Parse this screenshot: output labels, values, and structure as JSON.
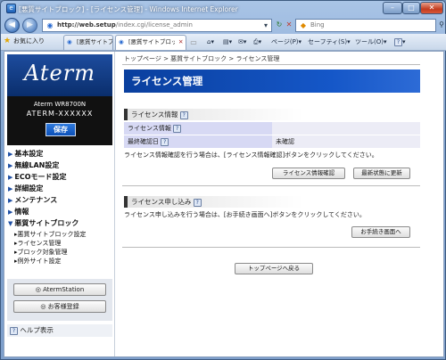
{
  "window": {
    "title": "[悪質サイトブロック] - [ライセンス管理] - Windows Internet Explorer",
    "controls": {
      "minimize": "–",
      "maximize": "□",
      "close": "✕"
    }
  },
  "address": {
    "url_prefix": "http://web.setup",
    "url_path": "/index.cgi/license_admin",
    "search_placeholder": "Bing",
    "back_icon": "back-arrow",
    "forward_icon": "forward-arrow"
  },
  "tabs": {
    "favorites_label": "お気に入り",
    "items": [
      {
        "label": "[悪質サイトブロック] - [ライセンス..."
      },
      {
        "label": "[悪質サイトブロック] - [ライセンス..."
      }
    ],
    "close_glyph": "✕"
  },
  "commandbar": {
    "page": "ページ(P)",
    "safety": "セーフティ(S)",
    "tools": "ツール(O)",
    "help_glyph": "?"
  },
  "sidebar": {
    "logo": "Aterm",
    "model_line1": "Aterm WR8700N",
    "model_line2": "ATERM-XXXXXX",
    "save_label": "保存",
    "menu": [
      {
        "label": "基本設定"
      },
      {
        "label": "無線LAN設定"
      },
      {
        "label": "ECOモード設定"
      },
      {
        "label": "詳細設定"
      },
      {
        "label": "メンテナンス"
      },
      {
        "label": "情報"
      },
      {
        "label": "悪質サイトブロック"
      }
    ],
    "submenu": [
      {
        "label": "悪質サイトブロック設定"
      },
      {
        "label": "ライセンス管理"
      },
      {
        "label": "ブロック対象管理"
      },
      {
        "label": "例外サイト設定"
      }
    ],
    "buttons": {
      "aterm_station": "AtermStation",
      "customer_register": "お客様登録"
    },
    "help_label": "ヘルプ表示"
  },
  "main": {
    "breadcrumb": "トップページ > 悪質サイトブロック > ライセンス管理",
    "title": "ライセンス管理",
    "license_info": {
      "heading": "ライセンス情報",
      "rows": [
        {
          "label": "ライセンス情報",
          "value": ""
        },
        {
          "label": "最終確認日",
          "value": "未確認"
        }
      ],
      "description": "ライセンス情報確認を行う場合は、[ライセンス情報確認]ボタンをクリックしてください。",
      "check_button": "ライセンス情報確認",
      "refresh_button": "最新状態に更新"
    },
    "license_apply": {
      "heading": "ライセンス申し込み",
      "description": "ライセンス申し込みを行う場合は、[お手続き画面へ]ボタンをクリックしてください。",
      "procedure_button": "お手続き画面へ"
    },
    "back_to_top_button": "トップページへ戻る"
  },
  "colors": {
    "accent_blue": "#1557c8",
    "row_label_bg": "#d7d9f4",
    "row_value_bg": "#ececf6"
  }
}
